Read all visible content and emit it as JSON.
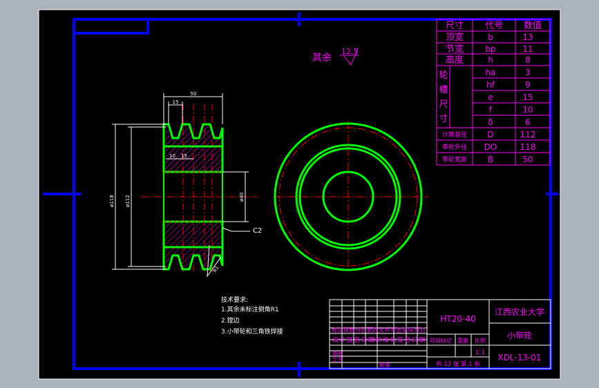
{
  "colors": {
    "background": "#a9b3bd",
    "canvas": "#000000",
    "frame": "#0000ff",
    "part": "#00ff00",
    "table": "#ff00ff",
    "annotation": "#ffffff",
    "centerline": "#ff0000",
    "dimension": "#ffff00"
  },
  "params_table": {
    "header": {
      "name": "尺寸",
      "code": "代号",
      "value": "数值"
    },
    "rows": [
      {
        "name": "顶宽",
        "code": "b",
        "value": "13"
      },
      {
        "name": "节宽",
        "code": "bp",
        "value": "11"
      },
      {
        "name": "高度",
        "code": "h",
        "value": "8"
      },
      {
        "name": "",
        "code": "ha",
        "value": "3"
      },
      {
        "name": "",
        "code": "hf",
        "value": "9"
      },
      {
        "name": "",
        "code": "e",
        "value": "15"
      },
      {
        "name": "",
        "code": "f",
        "value": "10"
      },
      {
        "name": "",
        "code": "δ",
        "value": "6"
      },
      {
        "name": "计算直径",
        "code": "D",
        "value": "112"
      },
      {
        "name": "带轮外径",
        "code": "DO",
        "value": "118"
      },
      {
        "name": "带轮宽度",
        "code": "B",
        "value": "50"
      }
    ],
    "group_label": [
      "轮",
      "槽",
      "尺",
      "寸"
    ]
  },
  "roughness": {
    "label": "其余",
    "value": "12.5"
  },
  "dimensions": {
    "overall_width": "50",
    "groove_pitch": "15",
    "d_left": "10",
    "d_right": "15",
    "dia_outer": "ø118",
    "dia_pitch": "ø112",
    "bore": "ø40",
    "chamfer": "C2",
    "fillet": "R1"
  },
  "tech_notes": {
    "title": "技术要求:",
    "items": [
      "1.其余未标注倒角R1",
      "2.镗边",
      "3.小带轮和三角铁焊接"
    ]
  },
  "title_block": {
    "material": "HT20-40",
    "school": "江西农业大学",
    "part_name": "小带轮",
    "drawing_no": "XDL-13-01",
    "row_marks": "标记处数分区更改文件号签名年月日",
    "row_design": "设计签名日期标准化签名日期",
    "stage_mark": "阶段标记",
    "weight": "重量",
    "scale_label": "比例",
    "scale": "1:1",
    "review": "审核",
    "process": "工艺",
    "approve": "批准",
    "sheets": "共 13 张 第 1 张"
  }
}
